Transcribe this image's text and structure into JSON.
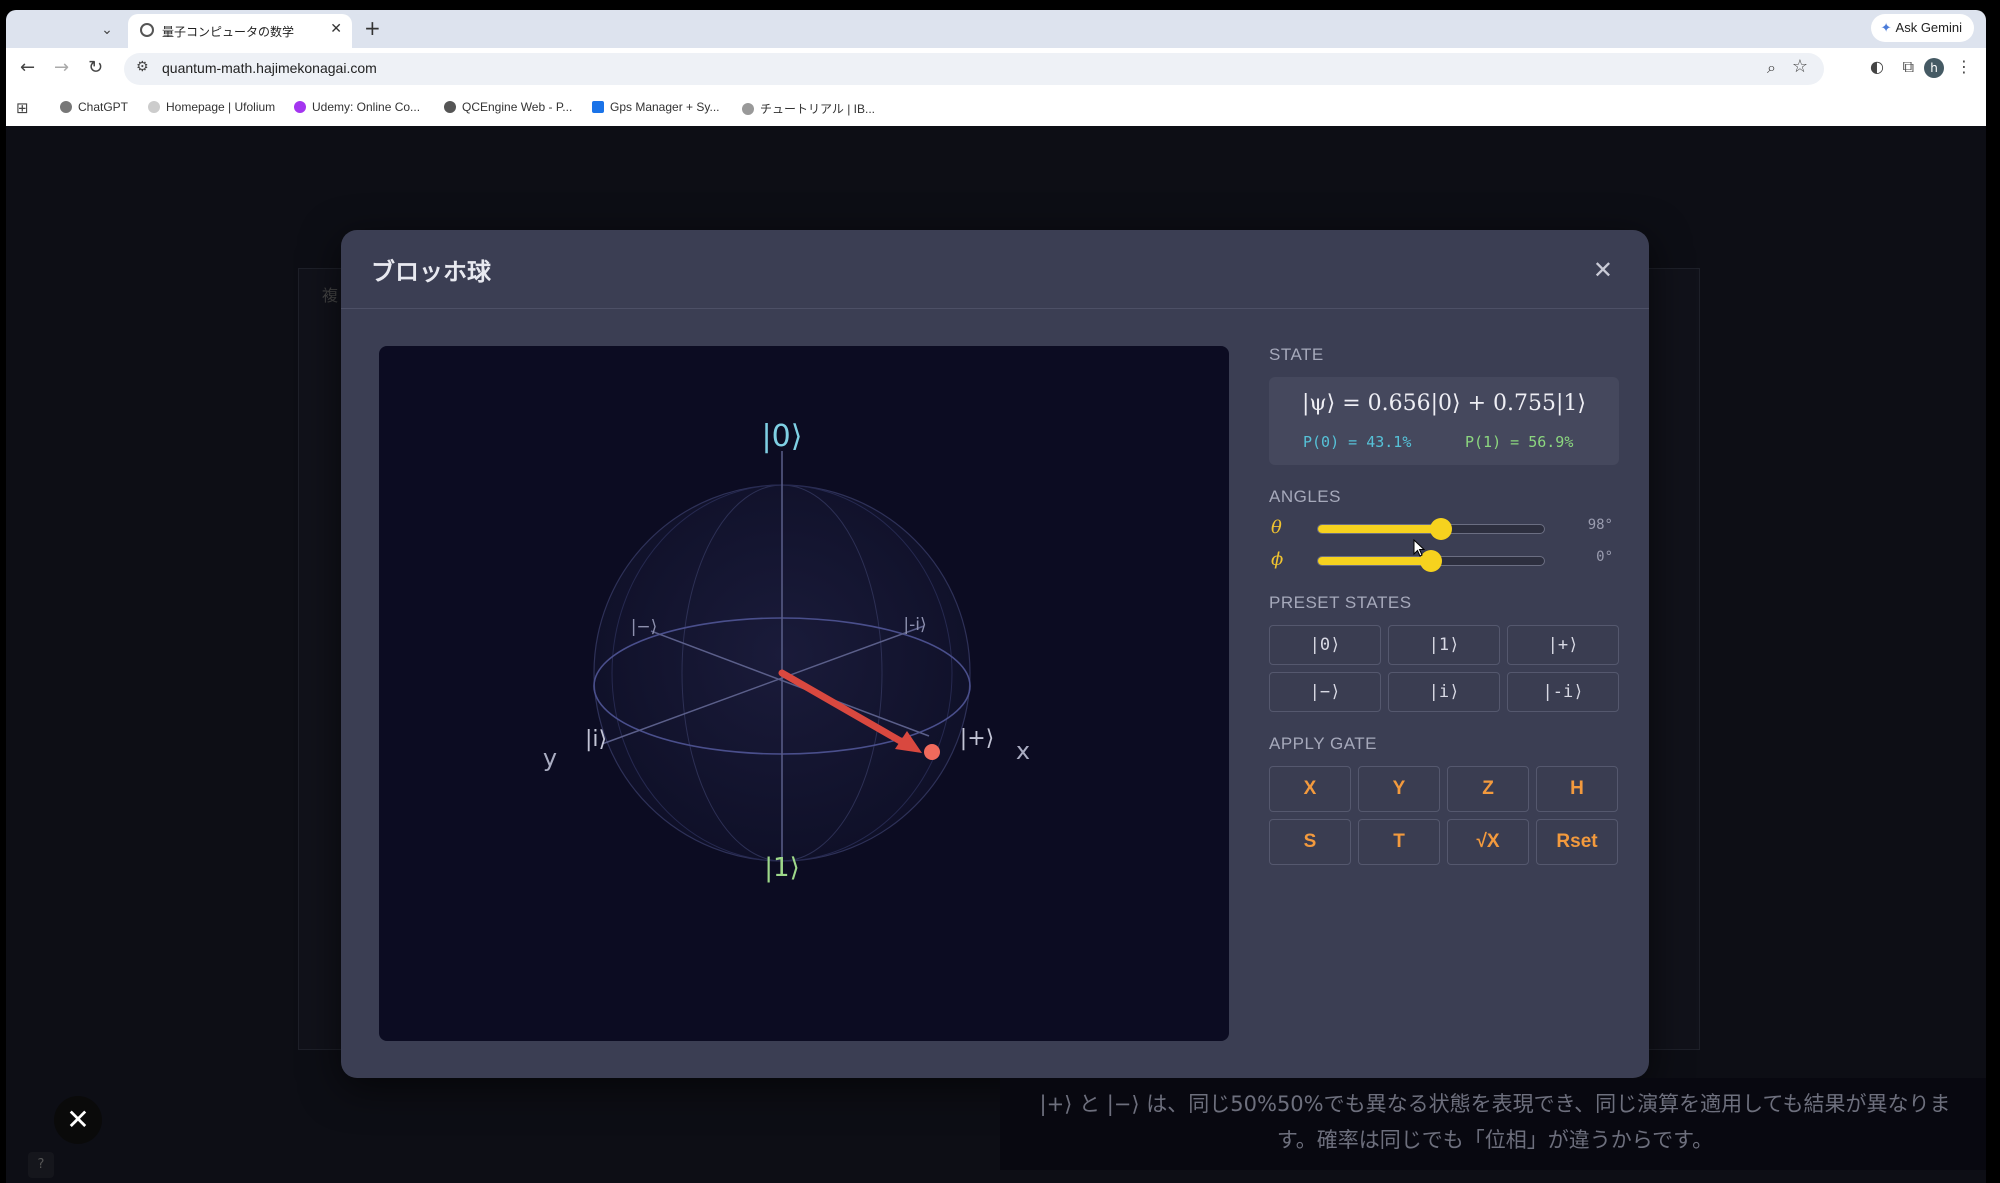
{
  "browser": {
    "tab_title": "量子コンピュータの数学",
    "new_tab": "+",
    "gemini_label": "Ask Gemini",
    "url": "quantum-math.hajimekonagai.com",
    "avatar_letter": "h",
    "bookmarks": [
      {
        "label": "ChatGPT",
        "color": "#777777"
      },
      {
        "label": "Homepage | Ufolium",
        "color": "#cccccc"
      },
      {
        "label": "Udemy: Online Co...",
        "color": "#a435f0"
      },
      {
        "label": "QCEngine Web - P...",
        "color": "#555555"
      },
      {
        "label": "Gps Manager + Sy...",
        "color": "#1a73e8"
      },
      {
        "label": "チュートリアル | IB...",
        "color": "#999999"
      }
    ]
  },
  "modal": {
    "title": "ブロッホ球",
    "close": "✕"
  },
  "sphere": {
    "labels": {
      "zero": "|0⟩",
      "one": "|1⟩",
      "plus": "|+⟩",
      "minus": "|−⟩",
      "i": "|i⟩",
      "minus_i": "|-i⟩",
      "x_axis": "x",
      "y_axis": "y"
    },
    "theta_deg": 98,
    "phi_deg": 0,
    "colors": {
      "vector": "#d9483f",
      "zero_label": "#7fd0e4",
      "one_label": "#9ed88a",
      "sphere_line": "#4a4f8c"
    }
  },
  "state": {
    "section": "STATE",
    "formula": "|ψ⟩ = 0.656|0⟩ + 0.755|1⟩",
    "p0": "P(0) = 43.1%",
    "p1": "P(1) = 56.9%"
  },
  "angles": {
    "section": "ANGLES",
    "theta_symbol": "θ",
    "phi_symbol": "ϕ",
    "theta_value": "98°",
    "phi_value": "0°",
    "theta_fraction": 0.544,
    "phi_fraction": 0.5
  },
  "presets": {
    "section": "PRESET STATES",
    "items": [
      "|0⟩",
      "|1⟩",
      "|+⟩",
      "|−⟩",
      "|i⟩",
      "|-i⟩"
    ]
  },
  "gates": {
    "section": "APPLY GATE",
    "items": [
      "X",
      "Y",
      "Z",
      "H",
      "S",
      "T",
      "√X",
      "Rset"
    ]
  },
  "caption": {
    "line1": "|+⟩ と |−⟩ は、同じ50%50%でも異なる状態を表現でき、同じ演算を適用しても結果が異なりま",
    "line2": "す。確率は同じでも「位相」が違うからです。"
  },
  "help": "?",
  "backdrop_char": "複",
  "video_progress": 0.59
}
